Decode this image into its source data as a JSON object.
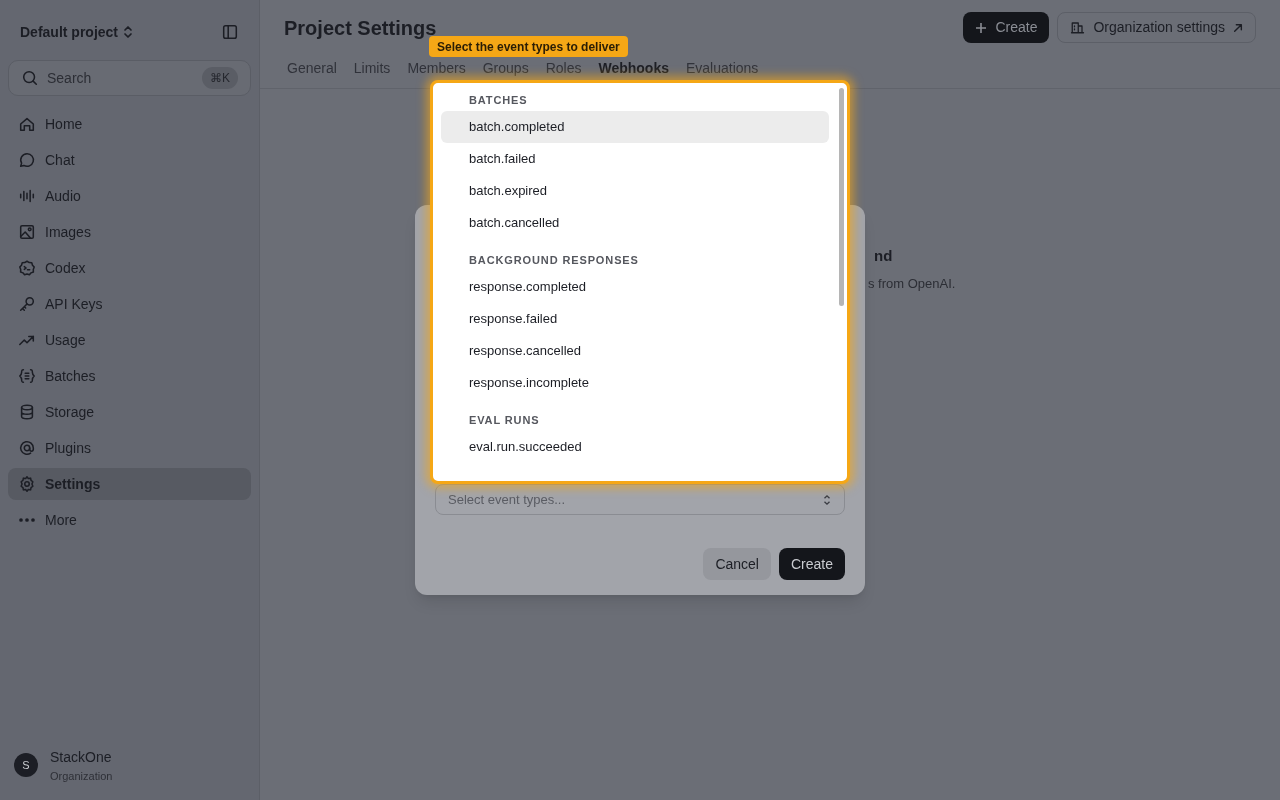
{
  "sidebar": {
    "project": "Default project",
    "search": {
      "placeholder": "Search",
      "shortcut": "⌘K"
    },
    "items": [
      {
        "label": "Home",
        "selected": false
      },
      {
        "label": "Chat",
        "selected": false
      },
      {
        "label": "Audio",
        "selected": false
      },
      {
        "label": "Images",
        "selected": false
      },
      {
        "label": "Codex",
        "selected": false
      },
      {
        "label": "API Keys",
        "selected": false
      },
      {
        "label": "Usage",
        "selected": false
      },
      {
        "label": "Batches",
        "selected": false
      },
      {
        "label": "Storage",
        "selected": false
      },
      {
        "label": "Plugins",
        "selected": false
      },
      {
        "label": "Settings",
        "selected": true
      },
      {
        "label": "More",
        "selected": false
      }
    ],
    "org": {
      "avatar": "S",
      "name": "StackOne",
      "subtitle": "Organization"
    }
  },
  "header": {
    "title": "Project Settings",
    "buttons": [
      {
        "label": "Create",
        "kind": "primary"
      },
      {
        "label": "Organization settings",
        "kind": "secondary"
      }
    ]
  },
  "tabs": [
    {
      "label": "General",
      "selected": false
    },
    {
      "label": "Limits",
      "selected": false
    },
    {
      "label": "Members",
      "selected": false
    },
    {
      "label": "Groups",
      "selected": false
    },
    {
      "label": "Roles",
      "selected": false
    },
    {
      "label": "Webhooks",
      "selected": true
    },
    {
      "label": "Evaluations",
      "selected": false
    }
  ],
  "empty_state": {
    "title": "nd",
    "description": "s from OpenAI."
  },
  "dialog": {
    "select": {
      "placeholder": "Select event types..."
    },
    "buttons": [
      {
        "label": "Cancel",
        "kind": "secondary"
      },
      {
        "label": "Create",
        "kind": "primary"
      }
    ]
  },
  "dropdown": {
    "tooltip": "Select the event types to deliver",
    "groups": [
      {
        "heading": "BATCHES",
        "options": [
          {
            "label": "batch.completed",
            "selected": true
          },
          {
            "label": "batch.failed",
            "selected": false
          },
          {
            "label": "batch.expired",
            "selected": false
          },
          {
            "label": "batch.cancelled",
            "selected": false
          }
        ]
      },
      {
        "heading": "BACKGROUND RESPONSES",
        "options": [
          {
            "label": "response.completed",
            "selected": false
          },
          {
            "label": "response.failed",
            "selected": false
          },
          {
            "label": "response.cancelled",
            "selected": false
          },
          {
            "label": "response.incomplete",
            "selected": false
          }
        ]
      },
      {
        "heading": "EVAL RUNS",
        "options": [
          {
            "label": "eval.run.succeeded",
            "selected": false
          }
        ]
      }
    ]
  }
}
